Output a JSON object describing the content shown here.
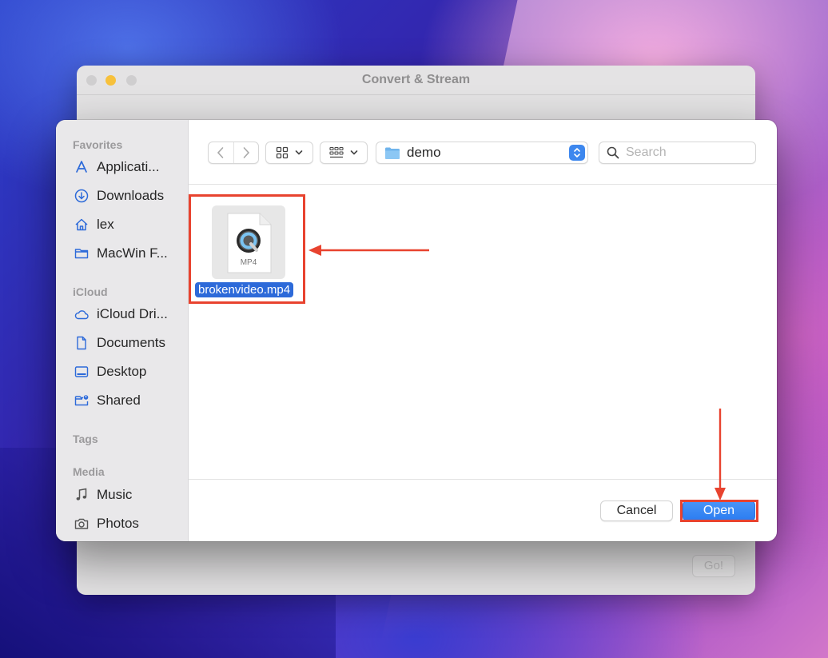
{
  "background_window": {
    "title": "Convert & Stream",
    "go_label": "Go!"
  },
  "dialog": {
    "sidebar": {
      "sections": [
        {
          "label": "Favorites",
          "items": [
            {
              "label": "Applicati...",
              "icon": "applications-icon"
            },
            {
              "label": "Downloads",
              "icon": "downloads-icon"
            },
            {
              "label": "lex",
              "icon": "home-icon"
            },
            {
              "label": "MacWin F...",
              "icon": "folder-icon"
            }
          ]
        },
        {
          "label": "iCloud",
          "items": [
            {
              "label": "iCloud Dri...",
              "icon": "icloud-icon"
            },
            {
              "label": "Documents",
              "icon": "document-icon"
            },
            {
              "label": "Desktop",
              "icon": "desktop-icon"
            },
            {
              "label": "Shared",
              "icon": "shared-folder-icon"
            }
          ]
        },
        {
          "label": "Tags",
          "items": []
        },
        {
          "label": "Media",
          "items": [
            {
              "label": "Music",
              "icon": "music-icon"
            },
            {
              "label": "Photos",
              "icon": "camera-icon"
            }
          ]
        }
      ]
    },
    "toolbar": {
      "path": "demo",
      "search_placeholder": "Search"
    },
    "files": [
      {
        "name": "brokenvideo.mp4",
        "type_label": "MP4",
        "selected": true
      }
    ],
    "buttons": {
      "cancel": "Cancel",
      "open": "Open"
    }
  },
  "colors": {
    "accent": "#2d6ad9",
    "annotation": "#e8432f"
  }
}
